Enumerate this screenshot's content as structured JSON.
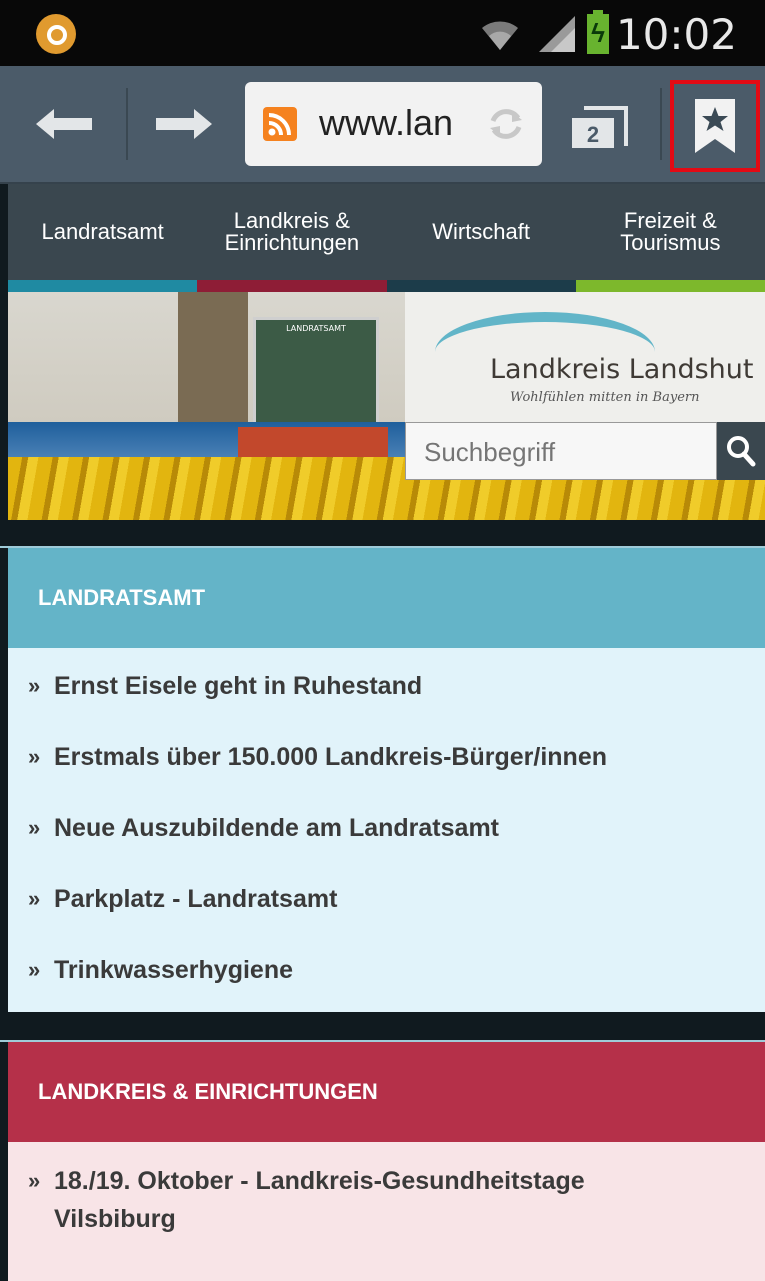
{
  "status_bar": {
    "time": "10:02",
    "battery_icon": "battery-charging-icon"
  },
  "browser": {
    "url": "www.lan",
    "tab_count": "2",
    "icons": [
      "back-arrow-icon",
      "forward-arrow-icon",
      "rss-icon",
      "reload-icon",
      "tabs-icon",
      "bookmark-star-icon"
    ]
  },
  "site_nav": {
    "items": [
      {
        "label": "Landratsamt"
      },
      {
        "label": "Landkreis &\nEinrichtungen"
      },
      {
        "label": "Wirtschaft"
      },
      {
        "label": "Freizeit &\nTourismus"
      }
    ],
    "stripe_colors": [
      "#1f8aa2",
      "#8e1d36",
      "#1c3c4a",
      "#7db82c"
    ]
  },
  "banner": {
    "logo_title": "Landkreis Landshut",
    "logo_subtitle": "Wohlfühlen mitten in Bayern",
    "door_sign": "LANDRATSAMT",
    "search_placeholder": "Suchbegriff"
  },
  "sections": [
    {
      "title": "LANDRATSAMT",
      "items": [
        "Ernst Eisele geht in Ruhestand",
        "Erstmals über 150.000 Landkreis-Bürger/innen",
        "Neue Auszubildende am Landratsamt",
        "Parkplatz - Landratsamt",
        "Trinkwasserhygiene"
      ]
    },
    {
      "title": "LANDKREIS & EINRICHTUNGEN",
      "items": [
        "18./19. Oktober - Landkreis-Gesundheitstage Vilsbiburg"
      ]
    }
  ],
  "bullet": "»"
}
